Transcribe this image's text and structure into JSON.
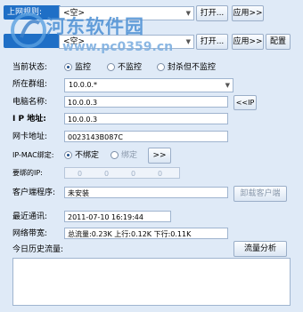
{
  "top": {
    "row1_label": "上网规则:",
    "row1_value": "<空>",
    "row2_value": "<空>",
    "open_label": "打开...",
    "apply_label": "应用>>",
    "config_label": "配置"
  },
  "watermark": {
    "title": "河东软件园",
    "url": "www.pc0359.cn"
  },
  "status": {
    "label": "当前状态:",
    "options": [
      "监控",
      "不监控",
      "封杀但不监控"
    ],
    "selected": "监控"
  },
  "group": {
    "label": "所在群组:",
    "value": "10.0.0.*"
  },
  "computer": {
    "label": "电脑名称:",
    "value": "10.0.0.3",
    "ip_button": "<<IP"
  },
  "ip": {
    "label": "I P 地址:",
    "value": "10.0.0.3"
  },
  "mac": {
    "label": "网卡地址:",
    "value": "0023143B087C"
  },
  "binding": {
    "label": "IP-MAC绑定:",
    "options": [
      "不绑定",
      "绑定"
    ],
    "selected": "不绑定",
    "more_button": ">>"
  },
  "bind_ip": {
    "label": "要绑的IP:",
    "octets": [
      "0",
      "0",
      "0",
      "0"
    ]
  },
  "client": {
    "label": "客户端程序:",
    "value": "未安装",
    "button": "卸载客户端"
  },
  "last_comm": {
    "label": "最近通讯:",
    "value": "2011-07-10 16:19:44"
  },
  "bandwidth": {
    "label": "网络带宽:",
    "value": "总流量:0.23K 上行:0.12K 下行:0.11K"
  },
  "history": {
    "label": "今日历史流量:",
    "button": "流量分析"
  }
}
